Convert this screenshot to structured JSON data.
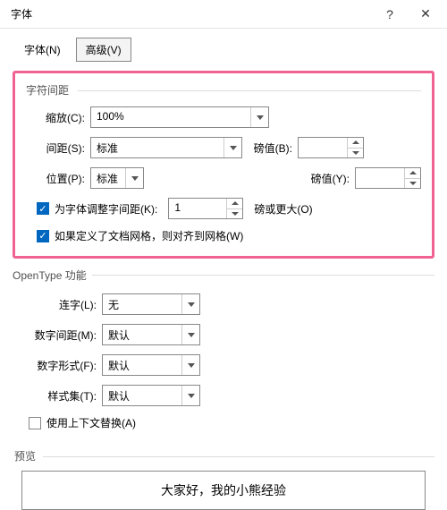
{
  "title": "字体",
  "tabs": {
    "font": "字体(N)",
    "advanced": "高级(V)"
  },
  "spacing": {
    "legend": "字符间距",
    "scale_label": "缩放(C):",
    "scale_value": "100%",
    "spacing_label": "间距(S):",
    "spacing_value": "标准",
    "pt1_label": "磅值(B):",
    "pt1_value": "",
    "position_label": "位置(P):",
    "position_value": "标准",
    "pt2_label": "磅值(Y):",
    "pt2_value": "",
    "kerning_label": "为字体调整字间距(K):",
    "kerning_value": "1",
    "kerning_suffix": "磅或更大(O)",
    "snap_label": "如果定义了文档网格，则对齐到网格(W)"
  },
  "opentype": {
    "legend": "OpenType 功能",
    "ligature_label": "连字(L):",
    "ligature_value": "无",
    "numspacing_label": "数字间距(M):",
    "numspacing_value": "默认",
    "numform_label": "数字形式(F):",
    "numform_value": "默认",
    "styleset_label": "样式集(T):",
    "styleset_value": "默认",
    "context_label": "使用上下文替换(A)"
  },
  "preview": {
    "legend": "预览",
    "text": "大家好，我的小熊经验"
  }
}
